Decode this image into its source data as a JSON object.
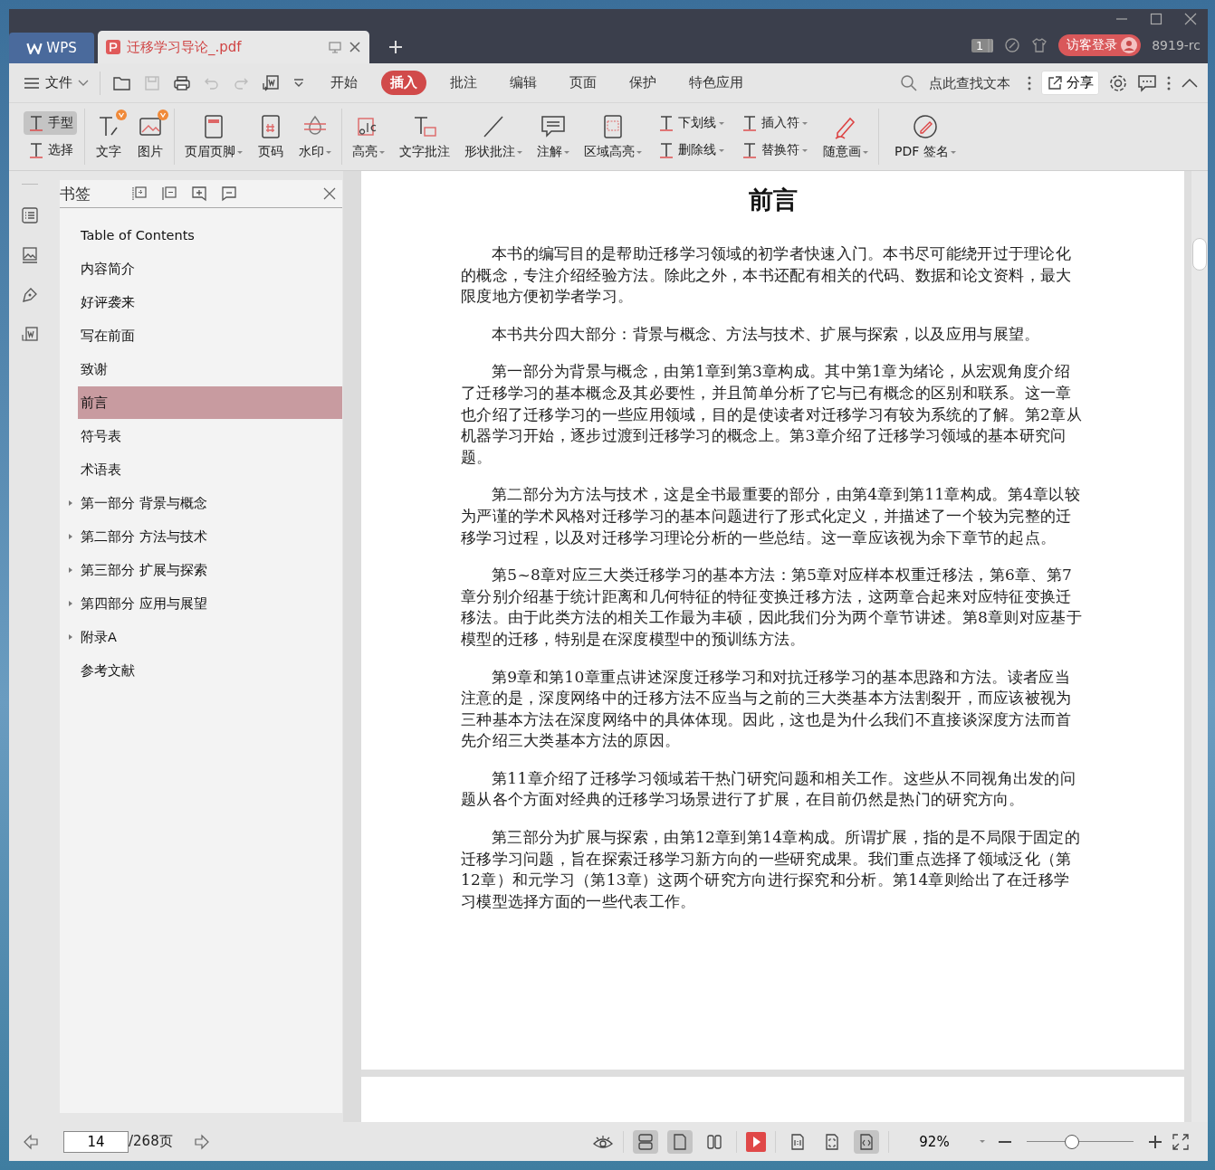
{
  "title_bar": {
    "app_tab": "WPS",
    "doc_tab": {
      "title": "迁移学习导论_.pdf",
      "selected": true
    },
    "badge": "1",
    "login": "访客登录",
    "version": "8919-rc"
  },
  "menu_bar": {
    "file_menu": "文件",
    "tabs": [
      {
        "label": "开始",
        "selected": false
      },
      {
        "label": "插入",
        "selected": true
      },
      {
        "label": "批注",
        "selected": false
      },
      {
        "label": "编辑",
        "selected": false
      },
      {
        "label": "页面",
        "selected": false
      },
      {
        "label": "保护",
        "selected": false
      },
      {
        "label": "特色应用",
        "selected": false
      }
    ],
    "search": {
      "placeholder": "点此查找文本"
    },
    "share": "分享"
  },
  "ribbon": {
    "groups": [
      {
        "tools": [
          {
            "kind": "stack",
            "items": [
              {
                "label": "手型",
                "selected": true,
                "dropdown": false
              },
              {
                "label": "选择",
                "selected": false,
                "dropdown": false
              }
            ]
          }
        ]
      },
      {
        "tools": [
          {
            "kind": "big",
            "label": "文字",
            "dropdown": false,
            "new": true
          },
          {
            "kind": "big",
            "label": "图片",
            "dropdown": false,
            "new": true
          }
        ]
      },
      {
        "tools": [
          {
            "kind": "big",
            "label": "页眉页脚",
            "dropdown": true,
            "new": false
          },
          {
            "kind": "big",
            "label": "页码",
            "dropdown": false,
            "new": false
          },
          {
            "kind": "big",
            "label": "水印",
            "dropdown": true,
            "new": false
          }
        ]
      },
      {
        "tools": [
          {
            "kind": "big",
            "label": "高亮",
            "dropdown": true,
            "new": false
          },
          {
            "kind": "big",
            "label": "文字批注",
            "dropdown": false,
            "new": false
          },
          {
            "kind": "big",
            "label": "形状批注",
            "dropdown": true,
            "new": false
          },
          {
            "kind": "big",
            "label": "注解",
            "dropdown": true,
            "new": false
          },
          {
            "kind": "big",
            "label": "区域高亮",
            "dropdown": true,
            "new": false
          },
          {
            "kind": "stack",
            "items": [
              {
                "label": "下划线",
                "selected": false,
                "dropdown": true
              },
              {
                "label": "删除线",
                "selected": false,
                "dropdown": true
              }
            ]
          },
          {
            "kind": "stack",
            "items": [
              {
                "label": "插入符",
                "selected": false,
                "dropdown": true
              },
              {
                "label": "替换符",
                "selected": false,
                "dropdown": true
              }
            ]
          },
          {
            "kind": "big",
            "label": "随意画",
            "dropdown": true,
            "new": false
          }
        ]
      },
      {
        "tools": [
          {
            "kind": "big",
            "label": "PDF 签名",
            "dropdown": true,
            "new": false
          }
        ]
      }
    ]
  },
  "bookmarks": {
    "title": "书签",
    "items": [
      {
        "label": "Table of Contents",
        "selected": false
      },
      {
        "label": "内容简介",
        "selected": false
      },
      {
        "label": "好评袭来",
        "selected": false
      },
      {
        "label": "写在前面",
        "selected": false
      },
      {
        "label": "致谢",
        "selected": false
      },
      {
        "label": "前言",
        "selected": true
      },
      {
        "label": "符号表",
        "selected": false
      },
      {
        "label": "术语表",
        "selected": false
      },
      {
        "label": "第一部分  背景与概念",
        "selected": false,
        "expanded": false
      },
      {
        "label": "第二部分  方法与技术",
        "selected": false,
        "expanded": false
      },
      {
        "label": "第三部分  扩展与探索",
        "selected": false,
        "expanded": false
      },
      {
        "label": "第四部分  应用与展望",
        "selected": false,
        "expanded": false
      },
      {
        "label": "附录A",
        "selected": false,
        "expanded": false
      },
      {
        "label": "参考文献",
        "selected": false
      }
    ]
  },
  "document": {
    "heading": "前言",
    "paragraphs": [
      "本书的编写目的是帮助迁移学习领域的初学者快速入门。本书尽可能绕开过于理论化的概念，专注介绍经验方法。除此之外，本书还配有相关的代码、数据和论文资料，最大限度地方便初学者学习。",
      "本书共分四大部分：背景与概念、方法与技术、扩展与探索，以及应用与展望。",
      "第一部分为背景与概念，由第1章到第3章构成。其中第1章为绪论，从宏观角度介绍了迁移学习的基本概念及其必要性，并且简单分析了它与已有概念的区别和联系。这一章也介绍了迁移学习的一些应用领域，目的是使读者对迁移学习有较为系统的了解。第2章从机器学习开始，逐步过渡到迁移学习的概念上。第3章介绍了迁移学习领域的基本研究问题。",
      "第二部分为方法与技术，这是全书最重要的部分，由第4章到第11章构成。第4章以较为严谨的学术风格对迁移学习的基本问题进行了形式化定义，并描述了一个较为完整的迁移学习过程，以及对迁移学习理论分析的一些总结。这一章应该视为余下章节的起点。",
      "第5~8章对应三大类迁移学习的基本方法：第5章对应样本权重迁移法，第6章、第7章分别介绍基于统计距离和几何特征的特征变换迁移方法，这两章合起来对应特征变换迁移法。由于此类方法的相关工作最为丰硕，因此我们分为两个章节讲述。第8章则对应基于模型的迁移，特别是在深度模型中的预训练方法。",
      "第9章和第10章重点讲述深度迁移学习和对抗迁移学习的基本思路和方法。读者应当注意的是，深度网络中的迁移方法不应当与之前的三大类基本方法割裂开，而应该被视为三种基本方法在深度网络中的具体体现。因此，这也是为什么我们不直接谈深度方法而首先介绍三大类基本方法的原因。",
      "第11章介绍了迁移学习领域若干热门研究问题和相关工作。这些从不同视角出发的问题从各个方面对经典的迁移学习场景进行了扩展，在目前仍然是热门的研究方向。",
      "第三部分为扩展与探索，由第12章到第14章构成。所谓扩展，指的是不局限于固定的迁移学习问题，旨在探索迁移学习新方向的一些研究成果。我们重点选择了领域泛化（第12章）和元学习（第13章）这两个研究方向进行探究和分析。第14章则给出了在迁移学习模型选择方面的一些代表工作。"
    ]
  },
  "status_bar": {
    "page_input": "14",
    "page_total": "/268页",
    "view_modes": [
      {
        "selected": true
      },
      {
        "selected": true
      },
      {
        "selected": false
      }
    ],
    "fit_modes": [
      {
        "selected": false
      },
      {
        "selected": false
      },
      {
        "selected": true
      }
    ],
    "zoom": "92%",
    "zoom_slider": {
      "level": 0.42
    }
  }
}
